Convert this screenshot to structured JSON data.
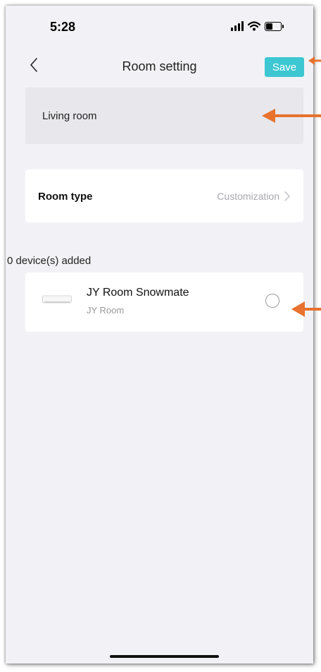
{
  "status_bar": {
    "time": "5:28"
  },
  "nav": {
    "title": "Room setting",
    "save_label": "Save"
  },
  "room_name": {
    "value": "Living room"
  },
  "room_type": {
    "label": "Room type",
    "value": "Customization"
  },
  "devices": {
    "count_label": "0 device(s) added",
    "items": [
      {
        "name": "JY Room Snowmate",
        "location": "JY Room",
        "selected": false
      }
    ]
  },
  "colors": {
    "accent": "#3cc7d2",
    "annotation_arrow": "#e8722e",
    "background": "#f2f2f6"
  }
}
